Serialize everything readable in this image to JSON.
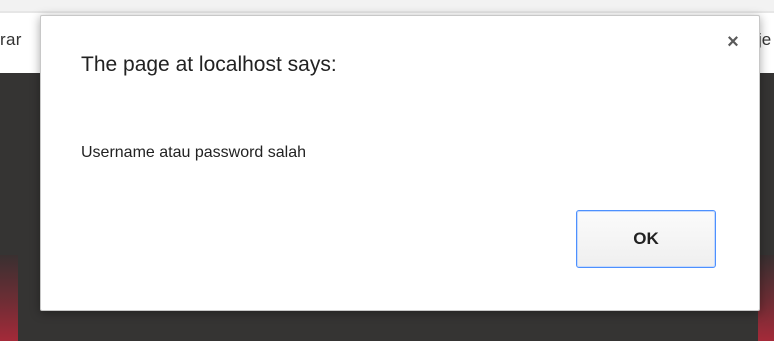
{
  "background": {
    "left_text": "rar",
    "right_text": "je"
  },
  "dialog": {
    "title": "The page at localhost says:",
    "message": "Username atau password salah",
    "ok_label": "OK",
    "close_glyph": "×",
    "close_icon": "close-icon"
  },
  "colors": {
    "dark_background": "#353433",
    "ok_focus_border": "#4d90fe",
    "accent_red": "#b8283a"
  }
}
